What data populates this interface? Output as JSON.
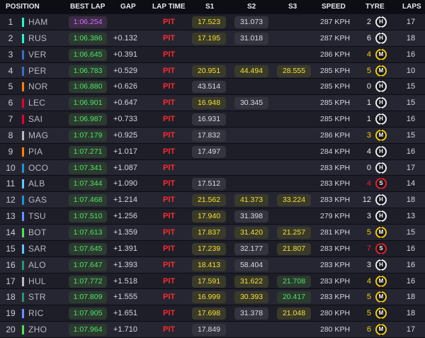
{
  "header": {
    "position": "POSITION",
    "best_lap": "BEST LAP",
    "gap": "GAP",
    "lap_time": "LAP TIME",
    "s1": "S1",
    "s2": "S2",
    "s3": "S3",
    "speed": "SPEED",
    "tyre": "TYRE",
    "laps": "LAPS"
  },
  "colors": {
    "tyre_hard": "#f0f0f0",
    "tyre_medium": "#f5d000",
    "tyre_soft": "#e8202a",
    "best_green": "#4fe36a",
    "best_purple": "#d56bff",
    "pit_red": "#ff2a2a"
  },
  "rows": [
    {
      "pos": "1",
      "driver": "HAM",
      "team_color": "#27f4d2",
      "best": "1:06.254",
      "best_purple": true,
      "gap": "",
      "lap": "PIT",
      "s1": "17.523",
      "s1c": "yellow",
      "s2": "31.073",
      "s2c": "white",
      "s3": "",
      "s3c": "",
      "speed": "287 KPH",
      "tyre_age": "2",
      "tyre": "H",
      "laps": "17"
    },
    {
      "pos": "2",
      "driver": "RUS",
      "team_color": "#27f4d2",
      "best": "1:06.386",
      "best_purple": false,
      "gap": "+0.132",
      "lap": "PIT",
      "s1": "17.195",
      "s1c": "yellow",
      "s2": "31.018",
      "s2c": "white",
      "s3": "",
      "s3c": "",
      "speed": "287 KPH",
      "tyre_age": "6",
      "tyre": "H",
      "laps": "18"
    },
    {
      "pos": "3",
      "driver": "VER",
      "team_color": "#3671c6",
      "best": "1:06.645",
      "best_purple": false,
      "gap": "+0.391",
      "lap": "PIT",
      "s1": "",
      "s1c": "",
      "s2": "",
      "s2c": "",
      "s3": "",
      "s3c": "",
      "speed": "286 KPH",
      "tyre_age": "4",
      "tyre": "M",
      "laps": "16"
    },
    {
      "pos": "4",
      "driver": "PER",
      "team_color": "#3671c6",
      "best": "1:06.783",
      "best_purple": false,
      "gap": "+0.529",
      "lap": "PIT",
      "s1": "20.951",
      "s1c": "yellow",
      "s2": "44.494",
      "s2c": "yellow",
      "s3": "28.555",
      "s3c": "yellow",
      "speed": "285 KPH",
      "tyre_age": "5",
      "tyre": "M",
      "laps": "10"
    },
    {
      "pos": "5",
      "driver": "NOR",
      "team_color": "#ff8000",
      "best": "1:06.880",
      "best_purple": false,
      "gap": "+0.626",
      "lap": "PIT",
      "s1": "43.514",
      "s1c": "white",
      "s2": "",
      "s2c": "",
      "s3": "",
      "s3c": "",
      "speed": "285 KPH",
      "tyre_age": "0",
      "tyre": "H",
      "laps": "15"
    },
    {
      "pos": "6",
      "driver": "LEC",
      "team_color": "#e8002d",
      "best": "1:06.901",
      "best_purple": false,
      "gap": "+0.647",
      "lap": "PIT",
      "s1": "16.948",
      "s1c": "yellow",
      "s2": "30.345",
      "s2c": "white",
      "s3": "",
      "s3c": "",
      "speed": "285 KPH",
      "tyre_age": "1",
      "tyre": "H",
      "laps": "15"
    },
    {
      "pos": "7",
      "driver": "SAI",
      "team_color": "#e8002d",
      "best": "1:06.987",
      "best_purple": false,
      "gap": "+0.733",
      "lap": "PIT",
      "s1": "16.931",
      "s1c": "white",
      "s2": "",
      "s2c": "",
      "s3": "",
      "s3c": "",
      "speed": "285 KPH",
      "tyre_age": "1",
      "tyre": "H",
      "laps": "16"
    },
    {
      "pos": "8",
      "driver": "MAG",
      "team_color": "#b6babd",
      "best": "1:07.179",
      "best_purple": false,
      "gap": "+0.925",
      "lap": "PIT",
      "s1": "17.832",
      "s1c": "white",
      "s2": "",
      "s2c": "",
      "s3": "",
      "s3c": "",
      "speed": "286 KPH",
      "tyre_age": "3",
      "tyre": "M",
      "laps": "15"
    },
    {
      "pos": "9",
      "driver": "PIA",
      "team_color": "#ff8000",
      "best": "1:07.271",
      "best_purple": false,
      "gap": "+1.017",
      "lap": "PIT",
      "s1": "17.497",
      "s1c": "white",
      "s2": "",
      "s2c": "",
      "s3": "",
      "s3c": "",
      "speed": "284 KPH",
      "tyre_age": "4",
      "tyre": "H",
      "laps": "16"
    },
    {
      "pos": "10",
      "driver": "OCO",
      "team_color": "#2293d1",
      "best": "1:07.341",
      "best_purple": false,
      "gap": "+1.087",
      "lap": "PIT",
      "s1": "",
      "s1c": "",
      "s2": "",
      "s2c": "",
      "s3": "",
      "s3c": "",
      "speed": "283 KPH",
      "tyre_age": "0",
      "tyre": "H",
      "laps": "17"
    },
    {
      "pos": "11",
      "driver": "ALB",
      "team_color": "#64c4ff",
      "best": "1:07.344",
      "best_purple": false,
      "gap": "+1.090",
      "lap": "PIT",
      "s1": "17.512",
      "s1c": "white",
      "s2": "",
      "s2c": "",
      "s3": "",
      "s3c": "",
      "speed": "283 KPH",
      "tyre_age": "4",
      "tyre": "S",
      "laps": "14"
    },
    {
      "pos": "12",
      "driver": "GAS",
      "team_color": "#2293d1",
      "best": "1:07.468",
      "best_purple": false,
      "gap": "+1.214",
      "lap": "PIT",
      "s1": "21.562",
      "s1c": "yellow",
      "s2": "41.373",
      "s2c": "yellow",
      "s3": "33.224",
      "s3c": "yellow",
      "speed": "283 KPH",
      "tyre_age": "12",
      "tyre": "H",
      "laps": "18"
    },
    {
      "pos": "13",
      "driver": "TSU",
      "team_color": "#6692ff",
      "best": "1:07.510",
      "best_purple": false,
      "gap": "+1.256",
      "lap": "PIT",
      "s1": "17.940",
      "s1c": "yellow",
      "s2": "31.398",
      "s2c": "white",
      "s3": "",
      "s3c": "",
      "speed": "279 KPH",
      "tyre_age": "3",
      "tyre": "H",
      "laps": "13"
    },
    {
      "pos": "14",
      "driver": "BOT",
      "team_color": "#52e252",
      "best": "1:07.613",
      "best_purple": false,
      "gap": "+1.359",
      "lap": "PIT",
      "s1": "17.837",
      "s1c": "yellow",
      "s2": "31.420",
      "s2c": "yellow",
      "s3": "21.257",
      "s3c": "yellow",
      "speed": "281 KPH",
      "tyre_age": "5",
      "tyre": "M",
      "laps": "15"
    },
    {
      "pos": "15",
      "driver": "SAR",
      "team_color": "#64c4ff",
      "best": "1:07.645",
      "best_purple": false,
      "gap": "+1.391",
      "lap": "PIT",
      "s1": "17.239",
      "s1c": "yellow",
      "s2": "32.177",
      "s2c": "white",
      "s3": "21.807",
      "s3c": "yellow",
      "speed": "283 KPH",
      "tyre_age": "7",
      "tyre": "S",
      "laps": "16"
    },
    {
      "pos": "16",
      "driver": "ALO",
      "team_color": "#229971",
      "best": "1:07.647",
      "best_purple": false,
      "gap": "+1.393",
      "lap": "PIT",
      "s1": "18.413",
      "s1c": "yellow",
      "s2": "58.404",
      "s2c": "white",
      "s3": "",
      "s3c": "",
      "speed": "283 KPH",
      "tyre_age": "3",
      "tyre": "H",
      "laps": "16"
    },
    {
      "pos": "17",
      "driver": "HUL",
      "team_color": "#b6babd",
      "best": "1:07.772",
      "best_purple": false,
      "gap": "+1.518",
      "lap": "PIT",
      "s1": "17.591",
      "s1c": "yellow",
      "s2": "31.622",
      "s2c": "yellow",
      "s3": "21.708",
      "s3c": "green",
      "speed": "283 KPH",
      "tyre_age": "4",
      "tyre": "M",
      "laps": "16"
    },
    {
      "pos": "18",
      "driver": "STR",
      "team_color": "#229971",
      "best": "1:07.809",
      "best_purple": false,
      "gap": "+1.555",
      "lap": "PIT",
      "s1": "16.999",
      "s1c": "yellow",
      "s2": "30.393",
      "s2c": "yellow",
      "s3": "20.417",
      "s3c": "green",
      "speed": "283 KPH",
      "tyre_age": "5",
      "tyre": "M",
      "laps": "18"
    },
    {
      "pos": "19",
      "driver": "RIC",
      "team_color": "#6692ff",
      "best": "1:07.905",
      "best_purple": false,
      "gap": "+1.651",
      "lap": "PIT",
      "s1": "17.698",
      "s1c": "yellow",
      "s2": "31.378",
      "s2c": "white",
      "s3": "21.048",
      "s3c": "yellow",
      "speed": "280 KPH",
      "tyre_age": "5",
      "tyre": "M",
      "laps": "18"
    },
    {
      "pos": "20",
      "driver": "ZHO",
      "team_color": "#52e252",
      "best": "1:07.964",
      "best_purple": false,
      "gap": "+1.710",
      "lap": "PIT",
      "s1": "17.849",
      "s1c": "white",
      "s2": "",
      "s2c": "",
      "s3": "",
      "s3c": "",
      "speed": "280 KPH",
      "tyre_age": "6",
      "tyre": "M",
      "laps": "17"
    }
  ]
}
